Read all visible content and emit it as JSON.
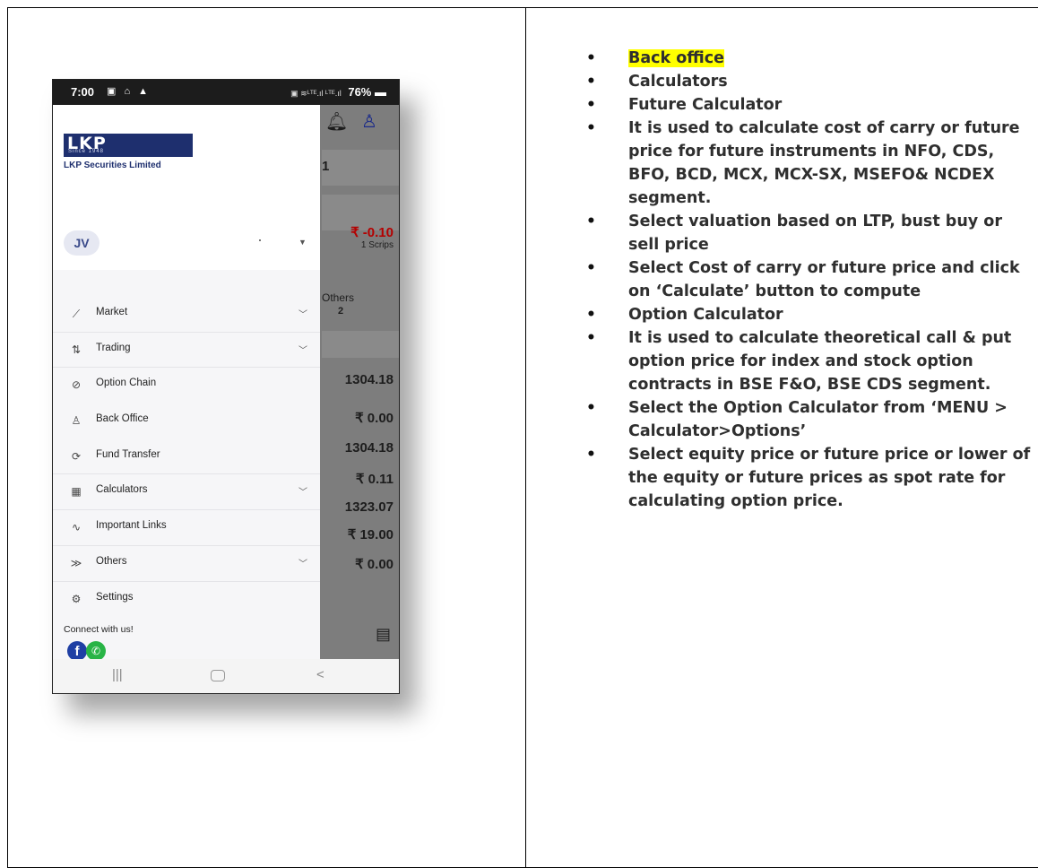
{
  "phone": {
    "status_time": "7:00",
    "status_icons": "▣ ⌂ ▲",
    "status_signal": "▣ ≋ᴸᵀᴱ.ıl ᴸᵀᴱ.ıl",
    "battery": "76%",
    "drawer": {
      "logo_text": "LKP",
      "logo_since": "Since 1948",
      "company": "LKP Securities Limited",
      "avatar_initials": "JV",
      "menu": [
        {
          "label": "Market",
          "icon": "chart-trend-icon",
          "glyph": "⟋",
          "chevron": true
        },
        {
          "label": "Trading",
          "icon": "trading-arrows-icon",
          "glyph": "⇅",
          "chevron": true
        },
        {
          "label": "Option Chain",
          "icon": "link-icon",
          "glyph": "⊘",
          "chevron": false
        },
        {
          "label": "Back Office",
          "icon": "people-icon",
          "glyph": "♙",
          "chevron": false
        },
        {
          "label": "Fund Transfer",
          "icon": "transfer-icon",
          "glyph": "⟳",
          "chevron": false
        },
        {
          "label": "Calculators",
          "icon": "calculator-icon",
          "glyph": "▦",
          "chevron": true
        },
        {
          "label": "Important Links",
          "icon": "wave-link-icon",
          "glyph": "∿",
          "chevron": false
        },
        {
          "label": "Others",
          "icon": "double-chevron-icon",
          "glyph": "≫",
          "chevron": true
        },
        {
          "label": "Settings",
          "icon": "gear-icon",
          "glyph": "⚙",
          "chevron": false
        }
      ],
      "connect_label": "Connect with us!"
    },
    "background": {
      "count_value": "1",
      "change_value": "₹ -0.10",
      "scrips": "1 Scrips",
      "others_label": "Others",
      "others_count": "2",
      "values": [
        "1304.18",
        "₹ 0.00",
        "1304.18",
        "₹ 0.11",
        "1323.07",
        "₹ 19.00",
        "₹ 0.00"
      ]
    }
  },
  "notes": [
    "Back office",
    "Calculators",
    "Future Calculator",
    "It is used to calculate cost of carry or future price for future instruments in NFO, CDS, BFO, BCD, MCX, MCX-SX, MSEFO& NCDEX segment.",
    "Select valuation based on LTP, bust buy or sell price",
    "Select Cost of carry or future price and click on ‘Calculate’ button to compute",
    "Option Calculator",
    "It is used to calculate theoretical call & put option price for index and stock option contracts in BSE F&O, BSE CDS segment.",
    "Select the Option Calculator from ‘MENU > Calculator>Options’",
    "Select equity price or future price or lower of the equity or future prices as spot rate for calculating option price."
  ],
  "colors": {
    "highlight": "#ffff00",
    "brand_navy": "#1e2f6e",
    "negative_red": "#b40000"
  }
}
